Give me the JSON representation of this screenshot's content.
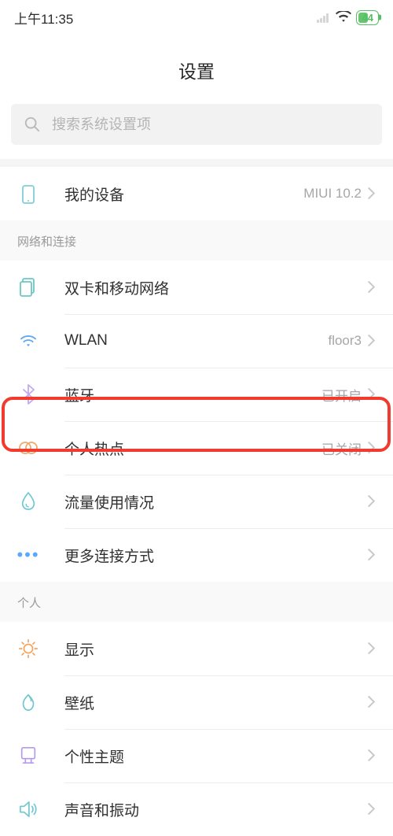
{
  "statusBar": {
    "time": "上午11:35",
    "battery": "44"
  },
  "header": {
    "title": "设置"
  },
  "search": {
    "placeholder": "搜索系统设置项"
  },
  "device": {
    "label": "我的设备",
    "value": "MIUI 10.2"
  },
  "sections": {
    "network": {
      "title": "网络和连接",
      "items": [
        {
          "label": "双卡和移动网络",
          "value": ""
        },
        {
          "label": "WLAN",
          "value": "floor3"
        },
        {
          "label": "蓝牙",
          "value": "已开启"
        },
        {
          "label": "个人热点",
          "value": "已关闭"
        },
        {
          "label": "流量使用情况",
          "value": ""
        },
        {
          "label": "更多连接方式",
          "value": ""
        }
      ]
    },
    "personal": {
      "title": "个人",
      "items": [
        {
          "label": "显示",
          "value": ""
        },
        {
          "label": "壁纸",
          "value": ""
        },
        {
          "label": "个性主题",
          "value": ""
        },
        {
          "label": "声音和振动",
          "value": ""
        }
      ]
    }
  }
}
